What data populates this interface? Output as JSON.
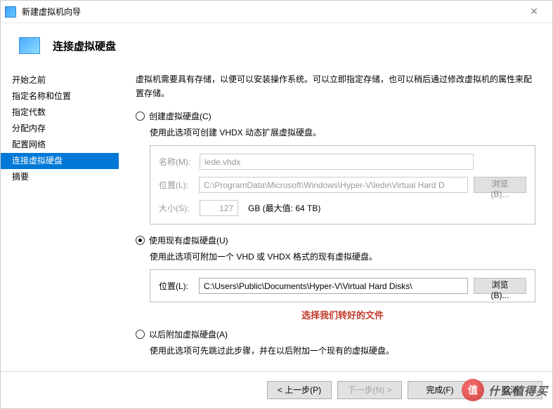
{
  "window": {
    "title": "新建虚拟机向导",
    "close_glyph": "✕"
  },
  "header": {
    "title": "连接虚拟硬盘"
  },
  "sidebar": {
    "items": [
      "开始之前",
      "指定名称和位置",
      "指定代数",
      "分配内存",
      "配置网络",
      "连接虚拟硬盘",
      "摘要"
    ],
    "active_index": 5
  },
  "content": {
    "intro": "虚拟机需要具有存储，以便可以安装操作系统。可以立即指定存储，也可以稍后通过修改虚拟机的属性来配置存储。",
    "opt_create": {
      "label": "创建虚拟硬盘(C)",
      "desc": "使用此选项可创建 VHDX 动态扩展虚拟硬盘。",
      "name_label": "名称(M):",
      "name_value": "lede.vhdx",
      "loc_label": "位置(L):",
      "loc_value": "C:\\ProgramData\\Microsoft\\Windows\\Hyper-V\\lede\\Virtual Hard D",
      "browse_label": "浏览(B)...",
      "size_label": "大小(S):",
      "size_value": "127",
      "size_unit": "GB (最大值: 64 TB)"
    },
    "opt_existing": {
      "label": "使用现有虚拟硬盘(U)",
      "desc": "使用此选项可附加一个 VHD 或 VHDX 格式的现有虚拟硬盘。",
      "loc_label": "位置(L):",
      "loc_value": "C:\\Users\\Public\\Documents\\Hyper-V\\Virtual Hard Disks\\",
      "browse_label": "浏览(B)..."
    },
    "annotation": "选择我们转好的文件",
    "opt_later": {
      "label": "以后附加虚拟硬盘(A)",
      "desc": "使用此选项可先跳过此步骤，并在以后附加一个现有的虚拟硬盘。"
    }
  },
  "footer": {
    "prev": "< 上一步(P)",
    "next": "下一步(N) >",
    "finish": "完成(F)",
    "cancel": "取消"
  },
  "watermark": {
    "circle": "值",
    "text": "什么值得买"
  }
}
